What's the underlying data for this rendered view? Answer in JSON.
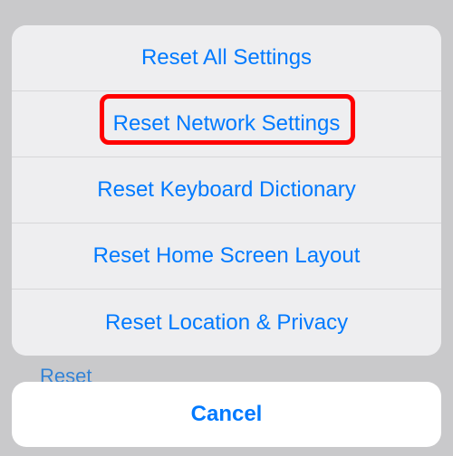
{
  "sheet": {
    "items": [
      {
        "label": "Reset All Settings"
      },
      {
        "label": "Reset Network Settings"
      },
      {
        "label": "Reset Keyboard Dictionary"
      },
      {
        "label": "Reset Home Screen Layout"
      },
      {
        "label": "Reset Location & Privacy"
      }
    ],
    "cancel": "Cancel"
  },
  "background": {
    "partial_text": "Reset"
  },
  "highlight": {
    "target_index": 1,
    "color": "#ff0000"
  }
}
